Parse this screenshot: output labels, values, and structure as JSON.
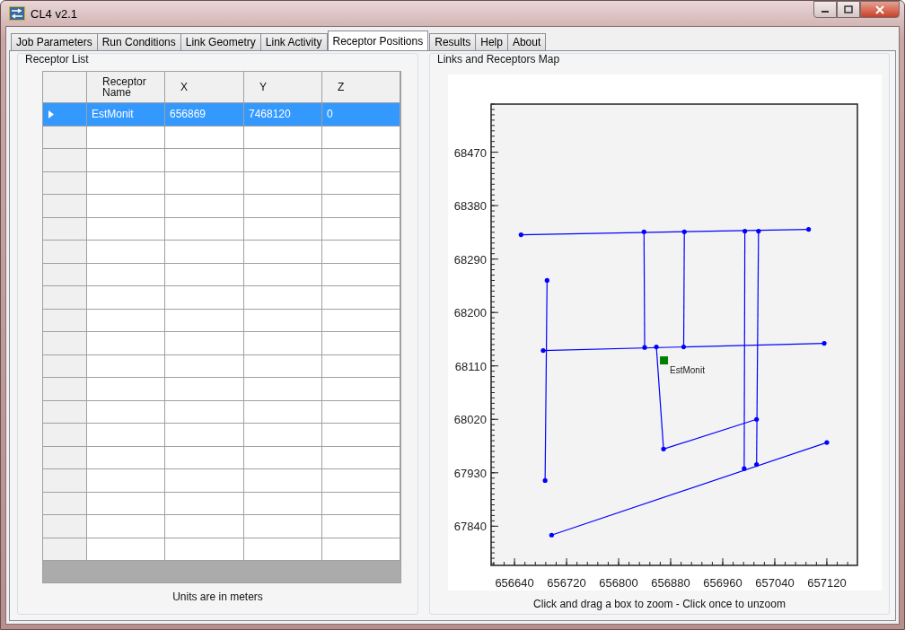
{
  "window": {
    "title": "CL4 v2.1"
  },
  "tabs": [
    {
      "label": "Job Parameters",
      "selected": false
    },
    {
      "label": "Run Conditions",
      "selected": false
    },
    {
      "label": "Link Geometry",
      "selected": false
    },
    {
      "label": "Link Activity",
      "selected": false
    },
    {
      "label": "Receptor Positions",
      "selected": true
    },
    {
      "label": "Results",
      "selected": false
    },
    {
      "label": "Help",
      "selected": false
    },
    {
      "label": "About",
      "selected": false
    }
  ],
  "receptor_list": {
    "title": "Receptor List",
    "columns": [
      "Receptor Name",
      "X",
      "Y",
      "Z"
    ],
    "rows": [
      {
        "cells": [
          "EstMonit",
          "656869",
          "7468120",
          "0"
        ],
        "selected": true
      }
    ],
    "note": "Units are in meters"
  },
  "map": {
    "title": "Links and Receptors Map",
    "hint": "Click and drag a box to zoom - Click once to unzoom",
    "chart_data": {
      "type": "line",
      "xlim": [
        656604,
        657167
      ],
      "ylim": [
        67774,
        68551
      ],
      "xticks": [
        656640,
        656720,
        656800,
        656880,
        656960,
        657040,
        657120
      ],
      "yticks": [
        67840,
        67930,
        68020,
        68110,
        68200,
        68290,
        68380,
        68470
      ],
      "series": [
        {
          "color": "#0000ff",
          "x": [
            656650,
            657092
          ],
          "values": [
            68331,
            68340
          ]
        },
        {
          "color": "#0000ff",
          "x": [
            656690,
            656687
          ],
          "values": [
            68254,
            67917
          ]
        },
        {
          "color": "#0000ff",
          "x": [
            656684,
            657116
          ],
          "values": [
            68136,
            68148
          ]
        },
        {
          "color": "#0000ff",
          "x": [
            656839,
            656840
          ],
          "values": [
            68336,
            68141
          ]
        },
        {
          "color": "#0000ff",
          "x": [
            656901,
            656900
          ],
          "values": [
            68336,
            68142
          ]
        },
        {
          "color": "#0000ff",
          "x": [
            656994,
            656993
          ],
          "values": [
            68337,
            67937
          ]
        },
        {
          "color": "#0000ff",
          "x": [
            657015,
            657012
          ],
          "values": [
            68337,
            67944
          ]
        },
        {
          "color": "#0000ff",
          "x": [
            656858,
            656869,
            657012
          ],
          "values": [
            68142,
            67970,
            68020
          ]
        },
        {
          "color": "#0000ff",
          "x": [
            656697,
            657120
          ],
          "values": [
            67825,
            67981
          ]
        }
      ],
      "annotations": [
        {
          "x": 656869,
          "y": 68120,
          "text": "EstMonit"
        }
      ]
    }
  }
}
